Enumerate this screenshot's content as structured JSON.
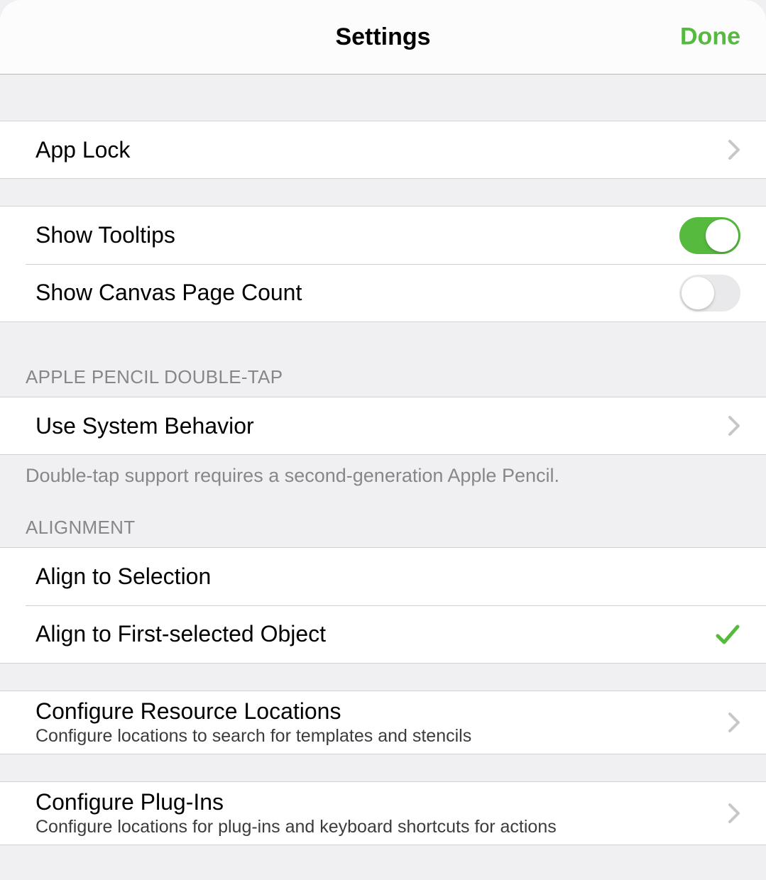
{
  "header": {
    "title": "Settings",
    "done": "Done"
  },
  "rows": {
    "app_lock": "App Lock",
    "show_tooltips": "Show Tooltips",
    "show_canvas_page_count": "Show Canvas Page Count",
    "use_system_behavior": "Use System Behavior",
    "align_to_selection": "Align to Selection",
    "align_to_first_selected": "Align to First-selected Object",
    "configure_resource_locations": {
      "title": "Configure Resource Locations",
      "subtitle": "Configure locations to search for templates and stencils"
    },
    "configure_plugins": {
      "title": "Configure Plug-Ins",
      "subtitle": "Configure locations for plug-ins and keyboard shortcuts for actions"
    }
  },
  "sections": {
    "apple_pencil": {
      "header": "APPLE PENCIL DOUBLE-TAP",
      "footer": "Double-tap support requires a second-generation Apple Pencil."
    },
    "alignment": {
      "header": "ALIGNMENT"
    }
  },
  "toggles": {
    "show_tooltips": true,
    "show_canvas_page_count": false
  },
  "selection": {
    "alignment": "first"
  },
  "colors": {
    "accent": "#56BA3F"
  }
}
